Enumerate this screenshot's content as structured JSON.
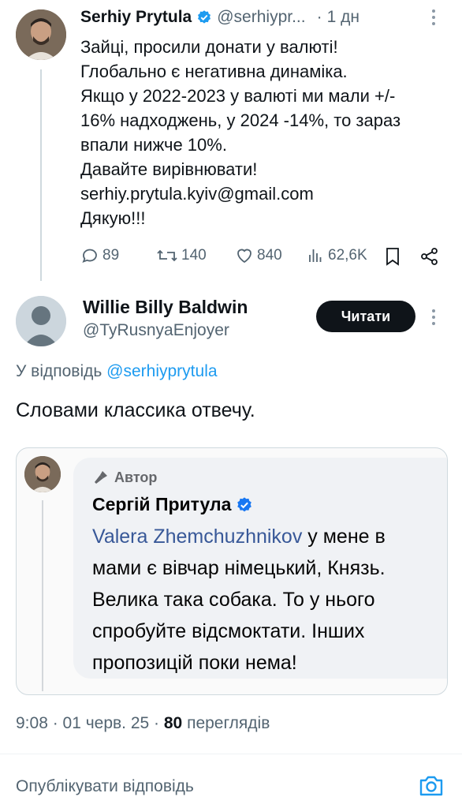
{
  "tweet": {
    "author_name": "Serhiy Prytula",
    "author_handle": "@serhiypr...",
    "separator": "·",
    "time": "1 дн",
    "lines": [
      "Зайці, просили донати у валюті!",
      "Глобально є негативна динаміка.",
      "Якщо у 2022-2023 у валюті ми мали +/-",
      "16% надходжень, у 2024 -14%, то зараз",
      "впали нижче 10%.",
      "Давайте вирівнювати!",
      "serhiy.prytula.kyiv@gmail.com",
      "Дякую!!!"
    ],
    "stats": {
      "replies": "89",
      "reposts": "140",
      "likes": "840",
      "views": "62,6K"
    }
  },
  "reply": {
    "author_name": "Willie Billy Baldwin",
    "author_handle": "@TyRusnyaEnjoyer",
    "follow_label": "Читати",
    "replying_prefix": "У відповідь",
    "replying_to": "@serhiyprytula",
    "text": "Словами классика отвечу.",
    "media": {
      "badge": "Автор",
      "name": "Сергій Притула",
      "tagged": "Valera Zhemchuzhnikov",
      "line1_rest": " у мене в",
      "line2": "мами є вівчар німецький, Князь.",
      "line3": "Велика така собака. То у нього",
      "line4": "спробуйте відсмоктати. Інших",
      "line5": "пропозицій поки нема!"
    },
    "meta_time": "9:08 · 01 черв. 25 · ",
    "meta_views_count": "80",
    "meta_views_label": " переглядів"
  },
  "compose": {
    "placeholder": "Опублікувати відповідь"
  },
  "colors": {
    "accent": "#1d9bf0",
    "text": "#0f1419",
    "muted": "#536471"
  },
  "icons": [
    "verified-badge-icon",
    "more-icon",
    "reply-icon",
    "repost-icon",
    "like-icon",
    "views-icon",
    "bookmark-icon",
    "share-icon",
    "mic-icon",
    "camera-icon"
  ]
}
